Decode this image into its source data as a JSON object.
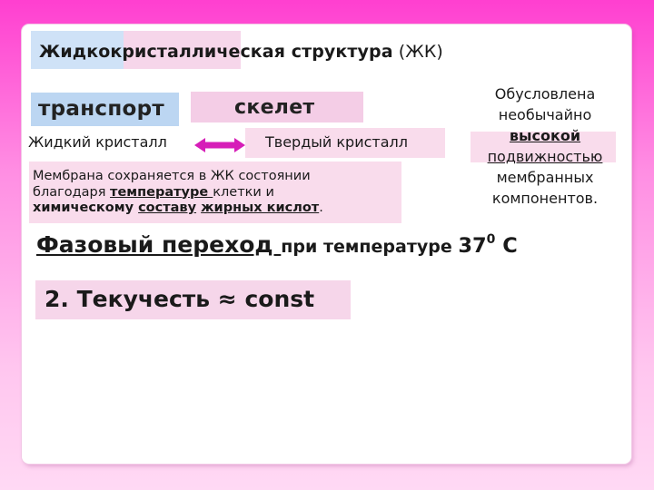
{
  "title": {
    "bold": "Жидкокристаллическая структура",
    "rest": " (ЖК)"
  },
  "transport": "транспорт",
  "skeleton": "скелет",
  "liquid_crystal": "Жидкий кристалл",
  "solid_crystal": "Твердый кристалл",
  "membrane": {
    "line1": "Мембрана сохраняется в ЖК состоянии",
    "line2_a": "благодаря ",
    "line2_u": "температуре ",
    "line2_b": "клетки и",
    "line3_a": "химическому",
    "line3_sp1": " ",
    "line3_u1": "составу",
    "line3_sp2": " ",
    "line3_u2": "жирных кислот",
    "line3_end": "."
  },
  "cause": {
    "line1": "Обусловлена",
    "line2": "необычайно",
    "line3": "высокой",
    "line4": "подвижностью",
    "line5": "мембранных",
    "line6": "компонентов."
  },
  "phase": {
    "underlined": "Фазовый переход ",
    "rest": "при температуре ",
    "value": "37",
    "sup": "0",
    "unit": " С"
  },
  "fluidity": "2. Текучесть ≈ const",
  "colors": {
    "background_top": "#ff3fd0",
    "background_bottom": "#ffd9f4",
    "box_blue": "#bcd6f2",
    "box_pink": "#f9dcec",
    "arrow": "#d61eb8"
  }
}
